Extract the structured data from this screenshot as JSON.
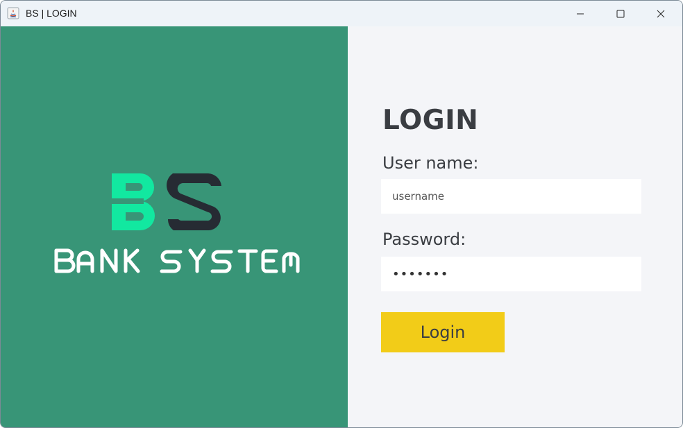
{
  "window": {
    "title": "BS | LOGIN"
  },
  "brand": {
    "monogram_left": "B",
    "monogram_right": "S",
    "name": "BANK SYSTEM",
    "colors": {
      "panel": "#389577",
      "b_letter": "#12e8a0",
      "s_letter": "#262b33"
    }
  },
  "form": {
    "heading": "LOGIN",
    "username_label": "User name:",
    "username_placeholder": "username",
    "username_value": "",
    "password_label": "Password:",
    "password_value": "•••••••",
    "submit_label": "Login",
    "submit_color": "#f2cc18"
  }
}
